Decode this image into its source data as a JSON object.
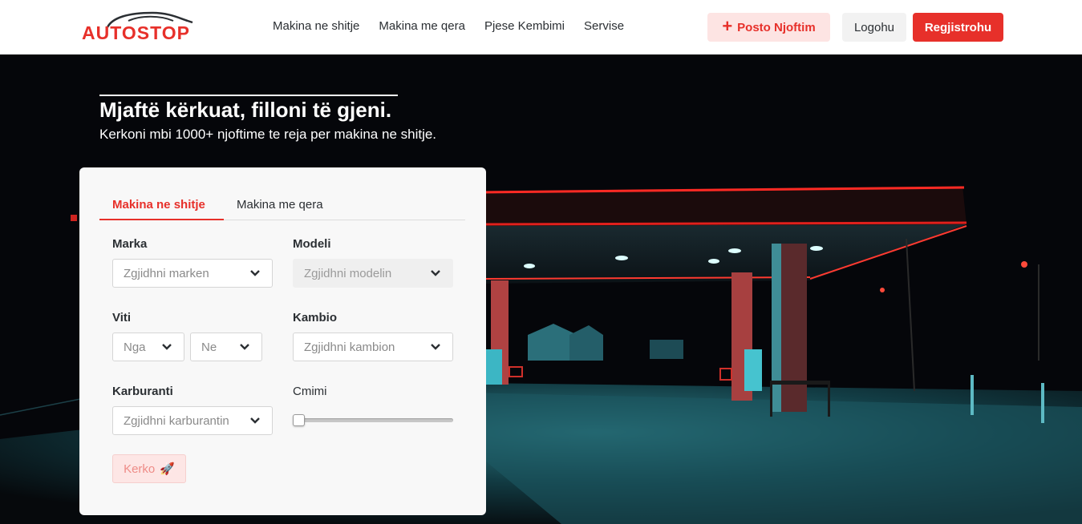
{
  "brand": {
    "logo_text": "AUTOSTOP",
    "accent": "#e7302a"
  },
  "nav": {
    "links": [
      "Makina ne shitje",
      "Makina me qera",
      "Pjese Kembimi",
      "Servise"
    ],
    "post_label": "Posto Njoftim",
    "login_label": "Logohu",
    "register_label": "Regjistrohu"
  },
  "hero": {
    "title": "Mjaftë kërkuat, filloni të gjeni.",
    "subtitle": "Kerkoni mbi 1000+ njoftime te reja per makina ne shitje."
  },
  "search": {
    "tabs": [
      "Makina ne shitje",
      "Makina me qera"
    ],
    "active_tab": "Makina ne shitje",
    "marka": {
      "label": "Marka",
      "placeholder": "Zgjidhni marken"
    },
    "modeli": {
      "label": "Modeli",
      "placeholder": "Zgjidhni modelin",
      "disabled": true
    },
    "viti": {
      "label": "Viti",
      "from_placeholder": "Nga",
      "to_placeholder": "Ne"
    },
    "kambio": {
      "label": "Kambio",
      "placeholder": "Zgjidhni kambion"
    },
    "karburanti": {
      "label": "Karburanti",
      "placeholder": "Zgjidhni karburantin"
    },
    "cmimi": {
      "label": "Cmimi",
      "slider_value": 0
    },
    "button_label": "Kerko",
    "button_icon": "rocket-icon"
  }
}
